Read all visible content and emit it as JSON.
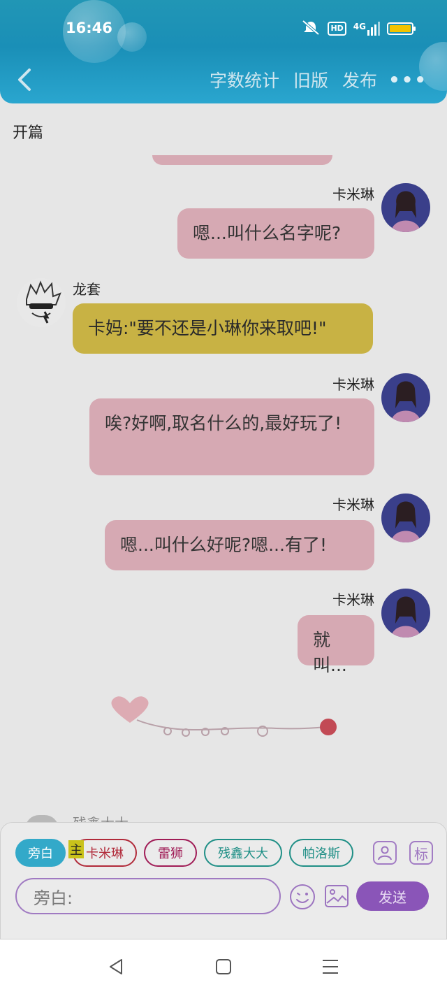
{
  "status_bar": {
    "time": "16:46",
    "hd": "HD",
    "network": "4G",
    "battery_color": "#f2c300"
  },
  "header": {
    "actions": [
      "字数统计",
      "旧版",
      "发布"
    ],
    "more": "•••"
  },
  "section_title": "开篇",
  "messages": [
    {
      "speaker": "卡米琳",
      "text": "嗯...叫什么名字呢?"
    },
    {
      "speaker": "龙套",
      "text": "卡妈:\"要不还是小琳你来取吧!\""
    },
    {
      "speaker": "卡米琳",
      "text": "唉?好啊,取名什么的,最好玩了!"
    },
    {
      "speaker": "卡米琳",
      "text": "嗯...叫什么好呢?嗯...有了!"
    },
    {
      "speaker": "卡米琳",
      "text": "就叫..."
    }
  ],
  "peek_name": "残鑫大大",
  "composer": {
    "characters": [
      "旁白",
      "卡米琳",
      "雷狮",
      "残鑫大大",
      "帕洛斯"
    ],
    "main_tag": "主",
    "tool_label": "标",
    "placeholder": "旁白:",
    "send_label": "发送"
  },
  "colors": {
    "accent": "#1a8fb7",
    "pink_bubble": "#d6a9b3",
    "yellow_bubble": "#c8b244",
    "send": "#8a55b8"
  }
}
